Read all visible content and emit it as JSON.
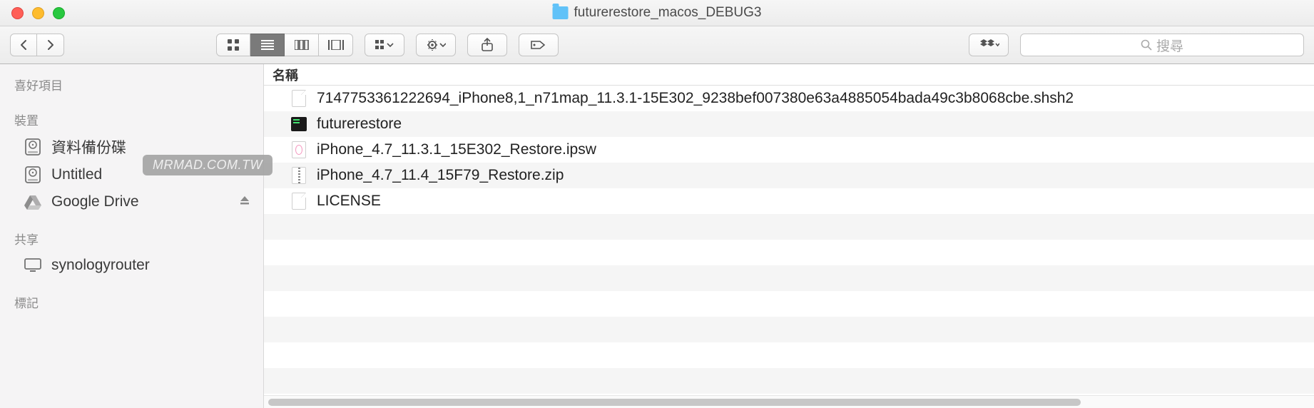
{
  "window": {
    "title": "futurerestore_macos_DEBUG3"
  },
  "toolbar": {
    "search_placeholder": "搜尋"
  },
  "sidebar": {
    "sections": {
      "favorites": "喜好項目",
      "devices": "裝置",
      "shared": "共享",
      "tags": "標記"
    },
    "devices": [
      {
        "label": "資料備份碟",
        "icon": "hdd",
        "eject": false
      },
      {
        "label": "Untitled",
        "icon": "hdd",
        "eject": true
      },
      {
        "label": "Google Drive",
        "icon": "gdrive",
        "eject": true
      }
    ],
    "shared": [
      {
        "label": "synologyrouter",
        "icon": "monitor"
      }
    ]
  },
  "content": {
    "column_header": "名稱",
    "files": [
      {
        "name": "7147753361222694_iPhone8,1_n71map_11.3.1-15E302_9238bef007380e63a4885054bada49c3b8068cbe.shsh2",
        "icon": "doc"
      },
      {
        "name": "futurerestore",
        "icon": "exec"
      },
      {
        "name": "iPhone_4.7_11.3.1_15E302_Restore.ipsw",
        "icon": "ipsw"
      },
      {
        "name": "iPhone_4.7_11.4_15F79_Restore.zip",
        "icon": "zip"
      },
      {
        "name": "LICENSE",
        "icon": "doc"
      }
    ]
  },
  "watermark": "MRMAD.COM.TW"
}
